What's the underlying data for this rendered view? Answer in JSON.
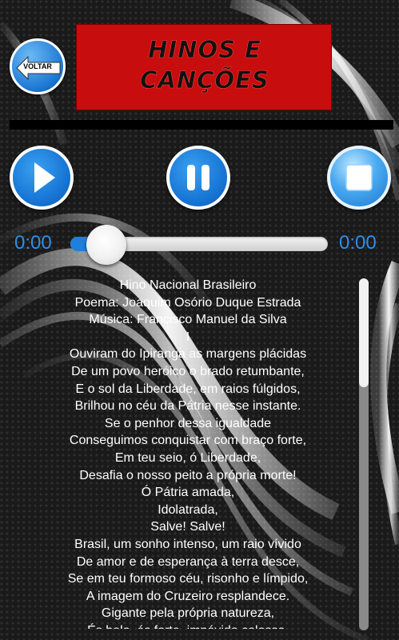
{
  "header": {
    "back_label": "VOLTAR",
    "title": "HINOS E\nCANÇÕES"
  },
  "player": {
    "current_time": "0:00",
    "total_time": "0:00",
    "progress": 0.0,
    "controls": [
      "play-icon",
      "pause-icon",
      "stop-icon"
    ]
  },
  "lyrics": {
    "lines": [
      "Hino Nacional Brasileiro",
      "Poema: Joaquim Osório Duque Estrada",
      "Música: Francisco Manuel da Silva",
      "I",
      "Ouviram do Ipiranga as margens plácidas",
      "De um povo heróico o brado retumbante,",
      "E o sol da Liberdade, em raios fúlgidos,",
      "Brilhou no céu da Pátria nesse instante.",
      "Se o penhor dessa igualdade",
      "Conseguimos conquistar com braço forte,",
      "Em teu seio, ó Liberdade,",
      "Desafia o nosso peito a própria morte!",
      "Ó Pátria amada,",
      "Idolatrada,",
      "Salve! Salve!",
      "Brasil, um sonho intenso, um raio vívido",
      "De amor e de esperança à terra desce,",
      "Se em teu formoso céu, risonho e límpido,",
      "A imagem do Cruzeiro resplandece.",
      "Gigante pela própria natureza,",
      "És belo, és forte, impávido colosso,"
    ]
  },
  "colors": {
    "accent_blue": "#1e7fdc",
    "title_red": "#c70d0d",
    "time_text": "#2f8fe8"
  }
}
